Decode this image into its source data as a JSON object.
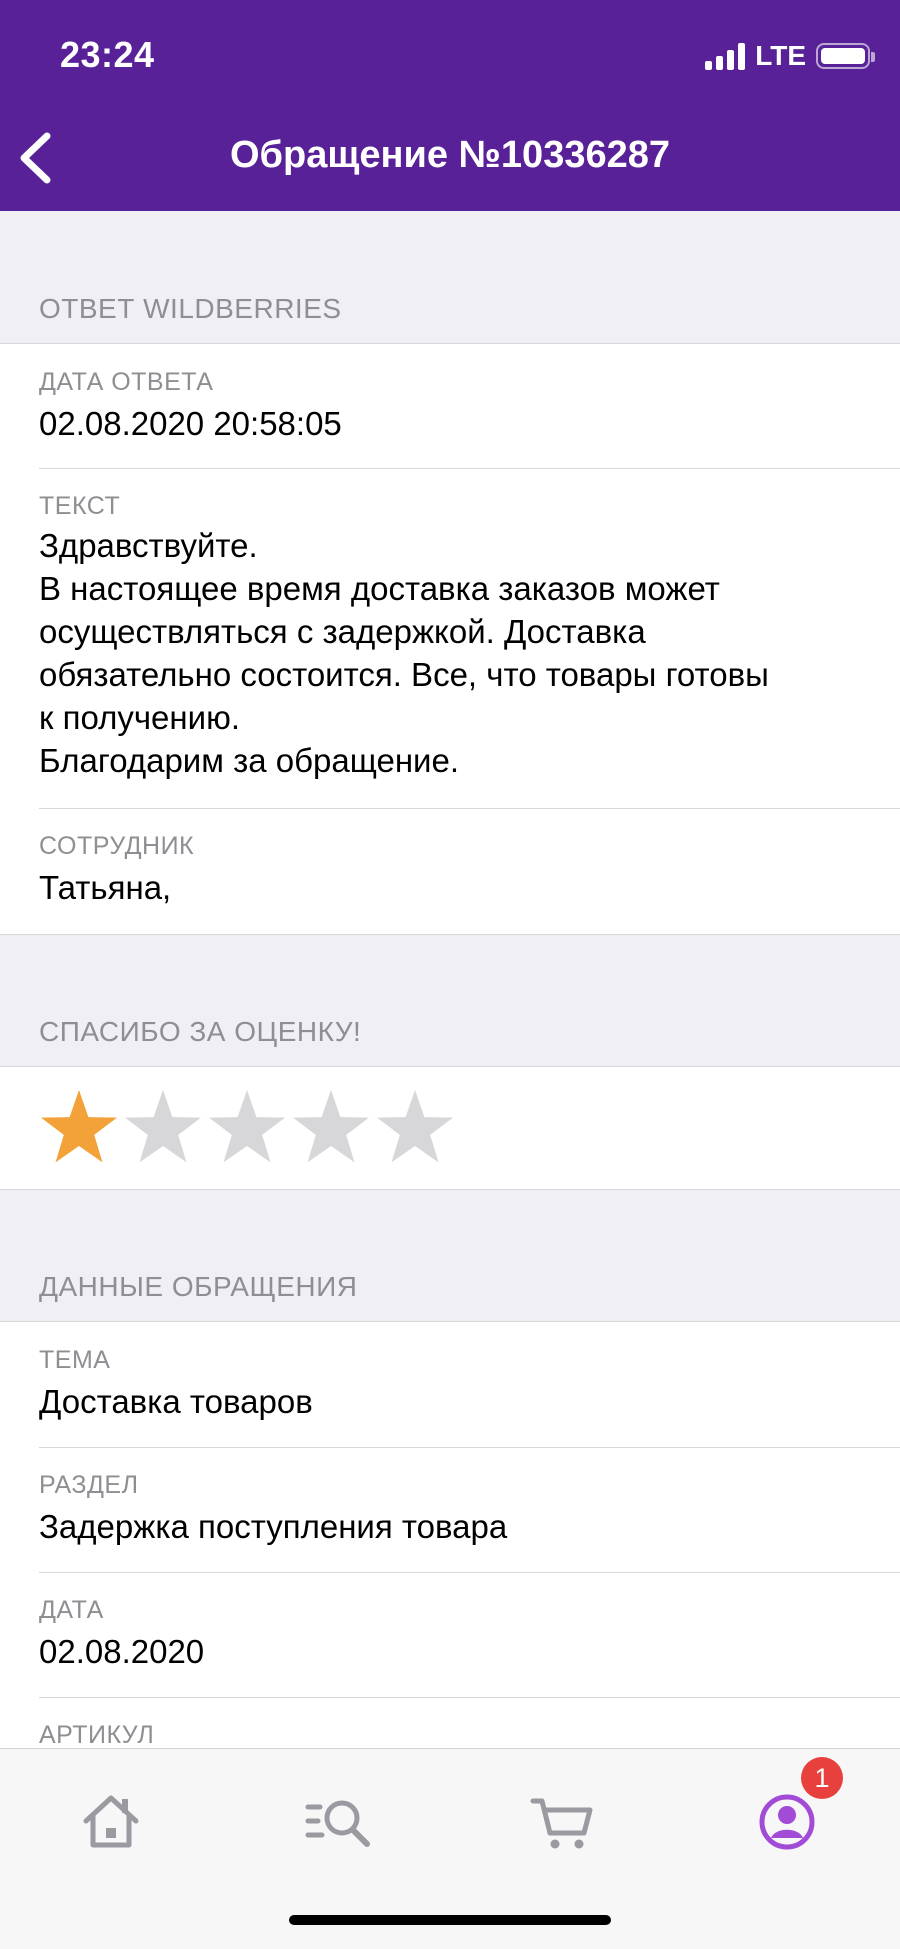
{
  "status_bar": {
    "time": "23:24",
    "network": "LTE"
  },
  "nav": {
    "title": "Обращение №10336287"
  },
  "response_section": {
    "header": "ОТВЕТ WILDBERRIES",
    "rows": [
      {
        "label": "ДАТА ОТВЕТА",
        "value": "02.08.2020 20:58:05"
      },
      {
        "label": "ТЕКСТ",
        "lines": [
          "Здравствуйте.",
          "В настоящее время доставка заказов может",
          "осуществляться с задержкой. Доставка",
          "обязательно состоится. Все, что товары готовы",
          "к получению.",
          "Благодарим за обращение."
        ]
      },
      {
        "label": "СОТРУДНИК",
        "value": "Татьяна,"
      }
    ]
  },
  "rating_section": {
    "header": "СПАСИБО ЗА ОЦЕНКУ!",
    "rating": 1,
    "max": 5,
    "active_color": "#f3a23a",
    "inactive_color": "#d7d7da"
  },
  "request_section": {
    "header": "ДАННЫЕ ОБРАЩЕНИЯ",
    "rows": [
      {
        "label": "ТЕМА",
        "value": "Доставка товаров"
      },
      {
        "label": "РАЗДЕЛ",
        "value": "Задержка поступления товара"
      },
      {
        "label": "ДАТА",
        "value": "02.08.2020"
      },
      {
        "label": "АРТИКУЛ",
        "value": ""
      }
    ]
  },
  "tabbar": {
    "tabs": [
      {
        "name": "home-icon"
      },
      {
        "name": "catalog-search-icon"
      },
      {
        "name": "cart-icon"
      },
      {
        "name": "profile-icon"
      }
    ],
    "profile_badge": "1",
    "colors": {
      "inactive": "#9a9aa0",
      "active": "#a24bd6",
      "badge": "#e8413d"
    }
  }
}
